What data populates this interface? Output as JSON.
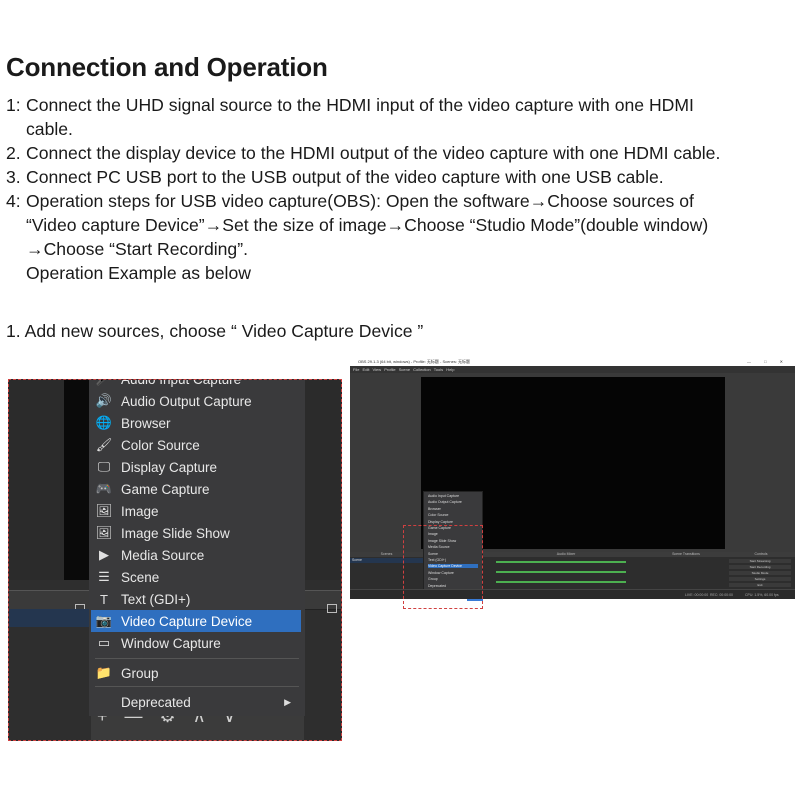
{
  "heading": "Connection and Operation",
  "steps": [
    {
      "num": "1:",
      "lines": [
        "Connect the UHD signal source to the HDMI input of the video capture with one HDMI",
        "cable."
      ]
    },
    {
      "num": "2.",
      "lines": [
        "Connect the display device to the HDMI output of the video capture with one HDMI cable."
      ]
    },
    {
      "num": "3.",
      "lines": [
        "Connect PC USB port to the USB output of the video capture with one USB cable."
      ]
    },
    {
      "num": "4:",
      "lines": [
        "Operation steps for USB video capture(OBS): Open the software→Choose sources of",
        "“Video capture Device”→Set the size of image→Choose “Studio Mode”(double window)",
        "→Choose “Start Recording”.",
        "Operation Example as below"
      ]
    }
  ],
  "sub_step": "1. Add new sources, choose “ Video Capture Device ”",
  "zoom_menu": {
    "items": [
      {
        "label": "Audio Input Capture",
        "icon": "microphone-icon",
        "glyph": "🎤"
      },
      {
        "label": "Audio Output Capture",
        "icon": "speaker-icon",
        "glyph": "🔊"
      },
      {
        "label": "Browser",
        "icon": "globe-icon",
        "glyph": "🌐"
      },
      {
        "label": "Color Source",
        "icon": "brush-icon",
        "glyph": "🖌"
      },
      {
        "label": "Display Capture",
        "icon": "monitor-icon",
        "glyph": "🖵"
      },
      {
        "label": "Game Capture",
        "icon": "gamepad-icon",
        "glyph": "🎮"
      },
      {
        "label": "Image",
        "icon": "image-icon",
        "glyph": "🖼"
      },
      {
        "label": "Image Slide Show",
        "icon": "slideshow-icon",
        "glyph": "🖼"
      },
      {
        "label": "Media Source",
        "icon": "play-icon",
        "glyph": "▶"
      },
      {
        "label": "Scene",
        "icon": "list-icon",
        "glyph": "☰"
      },
      {
        "label": "Text (GDI+)",
        "icon": "text-icon",
        "glyph": "T"
      },
      {
        "label": "Video Capture Device",
        "icon": "camera-icon",
        "glyph": "📷",
        "selected": true
      },
      {
        "label": "Window Capture",
        "icon": "window-icon",
        "glyph": "▭"
      },
      {
        "label": "Group",
        "icon": "folder-icon",
        "glyph": "📁"
      },
      {
        "label": "Deprecated",
        "icon": "",
        "glyph": "",
        "submenu": true
      }
    ],
    "bottom_tools": "+ — ⚙ ∧ ∨"
  },
  "obs_window": {
    "title": "OBS 29.1.3 (64 bit, windows) - Profile: 无标题 - Scenes: 无标题",
    "window_controls": "— □ ✕",
    "menubar": "File Edit View Profile Scene Collection Tools Help",
    "dock_headers": [
      "Scenes",
      "Sources",
      "Audio Mixer",
      "Scene Transitions",
      "Controls"
    ],
    "controls": [
      "Start Streaming",
      "Start Recording",
      "Studio Mode",
      "Settings",
      "Exit"
    ],
    "mini_menu": [
      "Audio Input Capture",
      "Audio Output Capture",
      "Browser",
      "Color Source",
      "Display Capture",
      "Game Capture",
      "Image",
      "Image Slide Show",
      "Media Source",
      "Scene",
      "Text (GDI+)",
      "Video Capture Device",
      "Window Capture",
      "Group",
      "Deprecated"
    ],
    "scene_item": "Scene",
    "status": {
      "live": "LIVE: 00:00:00",
      "rec": "REC: 00:00:00",
      "cpu": "CPU: 1.5%, 60.00 fps"
    }
  },
  "colors": {
    "menu_bg": "#3a3a3c",
    "selected": "#2f6fbf",
    "dash": "#d04040"
  }
}
